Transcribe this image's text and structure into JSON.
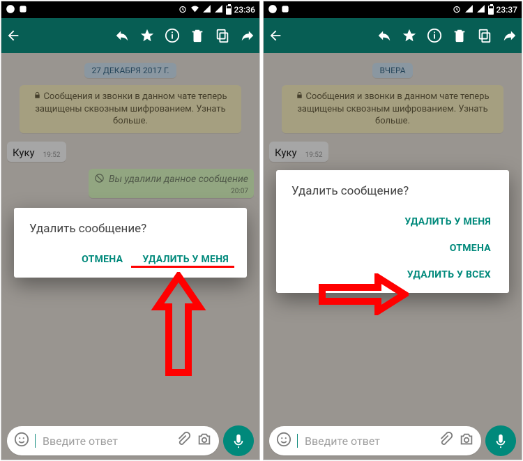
{
  "left": {
    "status_time": "23:36",
    "date_pill": "27 ДЕКАБРЯ 2017 Г.",
    "encryption_notice": "Сообщения и звонки в данном чате теперь защищены сквозным шифрованием. Узнать больше.",
    "msg_in": {
      "text": "Куку",
      "time": "19:52"
    },
    "msg_out": {
      "deleted_text": "Вы удалили данное сообщение",
      "time": "20:07"
    },
    "dialog": {
      "title": "Удалить сообщение?",
      "cancel": "ОТМЕНА",
      "delete_me": "УДАЛИТЬ У МЕНЯ"
    },
    "input_placeholder": "Введите ответ"
  },
  "right": {
    "status_time": "23:37",
    "date_pill": "ВЧЕРА",
    "encryption_notice": "Сообщения и звонки в данном чате теперь защищены сквозным шифрованием. Узнать больше.",
    "msg_in": {
      "text": "Куку",
      "time": "19:52"
    },
    "dialog": {
      "title": "Удалить сообщение?",
      "delete_me": "УДАЛИТЬ У МЕНЯ",
      "cancel": "ОТМЕНА",
      "delete_all": "УДАЛИТЬ У ВСЕХ"
    },
    "input_placeholder": "Введите ответ"
  },
  "colors": {
    "accent": "#075e54",
    "action": "#00897b",
    "annotation": "#ff0000"
  }
}
